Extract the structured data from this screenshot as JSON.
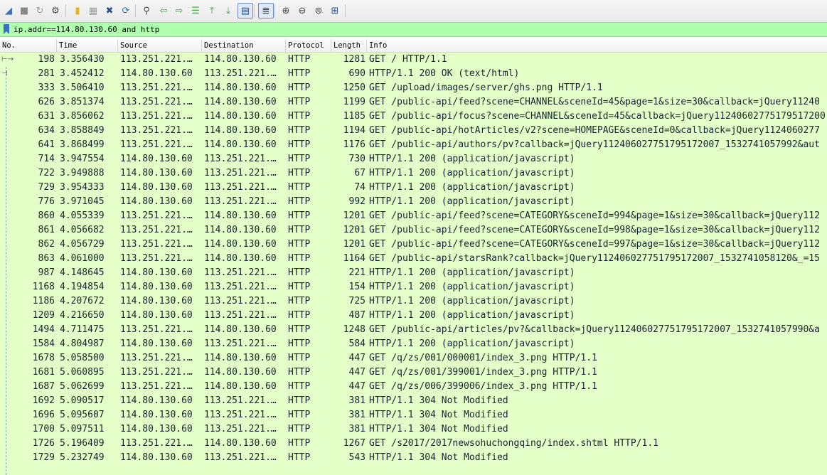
{
  "toolbar": {
    "buttons": [
      {
        "name": "start-capture-icon",
        "glyph": "◢",
        "color": "#3a6fc4"
      },
      {
        "name": "stop-capture-icon",
        "glyph": "■",
        "color": "#888888"
      },
      {
        "name": "restart-capture-icon",
        "glyph": "↻",
        "color": "#999999"
      },
      {
        "name": "capture-options-icon",
        "glyph": "⚙",
        "color": "#444444"
      },
      {
        "name": "open-file-icon",
        "glyph": "▮",
        "color": "#e0b020"
      },
      {
        "name": "save-file-icon",
        "glyph": "▦",
        "color": "#9a9a9a"
      },
      {
        "name": "close-file-icon",
        "glyph": "✖",
        "color": "#2b4f8a"
      },
      {
        "name": "reload-file-icon",
        "glyph": "⟳",
        "color": "#2e6fb5"
      },
      {
        "name": "find-packet-icon",
        "glyph": "⚲",
        "color": "#444444"
      },
      {
        "name": "go-back-icon",
        "glyph": "⇦",
        "color": "#4aa04a"
      },
      {
        "name": "go-forward-icon",
        "glyph": "⇨",
        "color": "#4aa04a"
      },
      {
        "name": "go-to-packet-icon",
        "glyph": "☰",
        "color": "#4aa04a"
      },
      {
        "name": "first-packet-icon",
        "glyph": "⤒",
        "color": "#4aa04a"
      },
      {
        "name": "last-packet-icon",
        "glyph": "⤓",
        "color": "#4aa04a"
      },
      {
        "name": "autoscroll-icon",
        "glyph": "▤",
        "color": "#2b4f8a",
        "active": true
      },
      {
        "name": "colorize-icon",
        "glyph": "≣",
        "color": "#333333",
        "active": true
      },
      {
        "name": "zoom-in-icon",
        "glyph": "⊕",
        "color": "#444444"
      },
      {
        "name": "zoom-out-icon",
        "glyph": "⊖",
        "color": "#444444"
      },
      {
        "name": "normal-size-icon",
        "glyph": "⊜",
        "color": "#444444"
      },
      {
        "name": "resize-columns-icon",
        "glyph": "⊞",
        "color": "#2b4f8a"
      }
    ]
  },
  "filter": {
    "value": "ip.addr==114.80.130.60 and http",
    "bookmark_color": "#3a6fc4",
    "bg_color": "#afffaf"
  },
  "columns": [
    "No.",
    "Time",
    "Source",
    "Destination",
    "Protocol",
    "Length",
    "Info"
  ],
  "rows": [
    {
      "no": "198",
      "time": "3.356430",
      "src": "113.251.221.…",
      "dst": "114.80.130.60",
      "proto": "HTTP",
      "len": "1281",
      "info": "GET / HTTP/1.1"
    },
    {
      "no": "281",
      "time": "3.452412",
      "src": "114.80.130.60",
      "dst": "113.251.221.…",
      "proto": "HTTP",
      "len": "690",
      "info": "HTTP/1.1 200 OK  (text/html)"
    },
    {
      "no": "333",
      "time": "3.506410",
      "src": "113.251.221.…",
      "dst": "114.80.130.60",
      "proto": "HTTP",
      "len": "1250",
      "info": "GET /upload/images/server/ghs.png HTTP/1.1"
    },
    {
      "no": "626",
      "time": "3.851374",
      "src": "113.251.221.…",
      "dst": "114.80.130.60",
      "proto": "HTTP",
      "len": "1199",
      "info": "GET /public-api/feed?scene=CHANNEL&sceneId=45&page=1&size=30&callback=jQuery11240"
    },
    {
      "no": "631",
      "time": "3.856062",
      "src": "113.251.221.…",
      "dst": "114.80.130.60",
      "proto": "HTTP",
      "len": "1185",
      "info": "GET /public-api/focus?scene=CHANNEL&sceneId=45&callback=jQuery11240602775179517200"
    },
    {
      "no": "634",
      "time": "3.858849",
      "src": "113.251.221.…",
      "dst": "114.80.130.60",
      "proto": "HTTP",
      "len": "1194",
      "info": "GET /public-api/hotArticles/v2?scene=HOMEPAGE&sceneId=0&callback=jQuery1124060277"
    },
    {
      "no": "641",
      "time": "3.868499",
      "src": "113.251.221.…",
      "dst": "114.80.130.60",
      "proto": "HTTP",
      "len": "1176",
      "info": "GET /public-api/authors/pv?callback=jQuery112406027751795172007_1532741057992&aut"
    },
    {
      "no": "714",
      "time": "3.947554",
      "src": "114.80.130.60",
      "dst": "113.251.221.…",
      "proto": "HTTP",
      "len": "730",
      "info": "HTTP/1.1 200   (application/javascript)"
    },
    {
      "no": "722",
      "time": "3.949888",
      "src": "114.80.130.60",
      "dst": "113.251.221.…",
      "proto": "HTTP",
      "len": "67",
      "info": "HTTP/1.1 200   (application/javascript)"
    },
    {
      "no": "729",
      "time": "3.954333",
      "src": "114.80.130.60",
      "dst": "113.251.221.…",
      "proto": "HTTP",
      "len": "74",
      "info": "HTTP/1.1 200   (application/javascript)"
    },
    {
      "no": "776",
      "time": "3.971045",
      "src": "114.80.130.60",
      "dst": "113.251.221.…",
      "proto": "HTTP",
      "len": "992",
      "info": "HTTP/1.1 200   (application/javascript)"
    },
    {
      "no": "860",
      "time": "4.055339",
      "src": "113.251.221.…",
      "dst": "114.80.130.60",
      "proto": "HTTP",
      "len": "1201",
      "info": "GET /public-api/feed?scene=CATEGORY&sceneId=994&page=1&size=30&callback=jQuery112"
    },
    {
      "no": "861",
      "time": "4.056682",
      "src": "113.251.221.…",
      "dst": "114.80.130.60",
      "proto": "HTTP",
      "len": "1201",
      "info": "GET /public-api/feed?scene=CATEGORY&sceneId=998&page=1&size=30&callback=jQuery112"
    },
    {
      "no": "862",
      "time": "4.056729",
      "src": "113.251.221.…",
      "dst": "114.80.130.60",
      "proto": "HTTP",
      "len": "1201",
      "info": "GET /public-api/feed?scene=CATEGORY&sceneId=997&page=1&size=30&callback=jQuery112"
    },
    {
      "no": "863",
      "time": "4.061000",
      "src": "113.251.221.…",
      "dst": "114.80.130.60",
      "proto": "HTTP",
      "len": "1164",
      "info": "GET /public-api/starsRank?callback=jQuery112406027751795172007_1532741058120&_=15"
    },
    {
      "no": "987",
      "time": "4.148645",
      "src": "114.80.130.60",
      "dst": "113.251.221.…",
      "proto": "HTTP",
      "len": "221",
      "info": "HTTP/1.1 200   (application/javascript)"
    },
    {
      "no": "1168",
      "time": "4.194854",
      "src": "114.80.130.60",
      "dst": "113.251.221.…",
      "proto": "HTTP",
      "len": "154",
      "info": "HTTP/1.1 200   (application/javascript)"
    },
    {
      "no": "1186",
      "time": "4.207672",
      "src": "114.80.130.60",
      "dst": "113.251.221.…",
      "proto": "HTTP",
      "len": "725",
      "info": "HTTP/1.1 200   (application/javascript)"
    },
    {
      "no": "1209",
      "time": "4.216650",
      "src": "114.80.130.60",
      "dst": "113.251.221.…",
      "proto": "HTTP",
      "len": "487",
      "info": "HTTP/1.1 200   (application/javascript)"
    },
    {
      "no": "1494",
      "time": "4.711475",
      "src": "113.251.221.…",
      "dst": "114.80.130.60",
      "proto": "HTTP",
      "len": "1248",
      "info": "GET /public-api/articles/pv?&callback=jQuery112406027751795172007_1532741057990&a"
    },
    {
      "no": "1584",
      "time": "4.804987",
      "src": "114.80.130.60",
      "dst": "113.251.221.…",
      "proto": "HTTP",
      "len": "584",
      "info": "HTTP/1.1 200   (application/javascript)"
    },
    {
      "no": "1678",
      "time": "5.058500",
      "src": "113.251.221.…",
      "dst": "114.80.130.60",
      "proto": "HTTP",
      "len": "447",
      "info": "GET /q/zs/001/000001/index_3.png HTTP/1.1"
    },
    {
      "no": "1681",
      "time": "5.060895",
      "src": "113.251.221.…",
      "dst": "114.80.130.60",
      "proto": "HTTP",
      "len": "447",
      "info": "GET /q/zs/001/399001/index_3.png HTTP/1.1"
    },
    {
      "no": "1687",
      "time": "5.062699",
      "src": "113.251.221.…",
      "dst": "114.80.130.60",
      "proto": "HTTP",
      "len": "447",
      "info": "GET /q/zs/006/399006/index_3.png HTTP/1.1"
    },
    {
      "no": "1692",
      "time": "5.090517",
      "src": "114.80.130.60",
      "dst": "113.251.221.…",
      "proto": "HTTP",
      "len": "381",
      "info": "HTTP/1.1 304 Not Modified"
    },
    {
      "no": "1696",
      "time": "5.095607",
      "src": "114.80.130.60",
      "dst": "113.251.221.…",
      "proto": "HTTP",
      "len": "381",
      "info": "HTTP/1.1 304 Not Modified"
    },
    {
      "no": "1700",
      "time": "5.097511",
      "src": "114.80.130.60",
      "dst": "113.251.221.…",
      "proto": "HTTP",
      "len": "381",
      "info": "HTTP/1.1 304 Not Modified"
    },
    {
      "no": "1726",
      "time": "5.196409",
      "src": "113.251.221.…",
      "dst": "114.80.130.60",
      "proto": "HTTP",
      "len": "1267",
      "info": "GET /s2017/2017newsohuchongqing/index.shtml HTTP/1.1"
    },
    {
      "no": "1729",
      "time": "5.232749",
      "src": "114.80.130.60",
      "dst": "113.251.221.…",
      "proto": "HTTP",
      "len": "543",
      "info": "HTTP/1.1 304 Not Modified"
    }
  ],
  "colors": {
    "row_bg": "#e4ffc7",
    "row_text": "#12272e"
  }
}
